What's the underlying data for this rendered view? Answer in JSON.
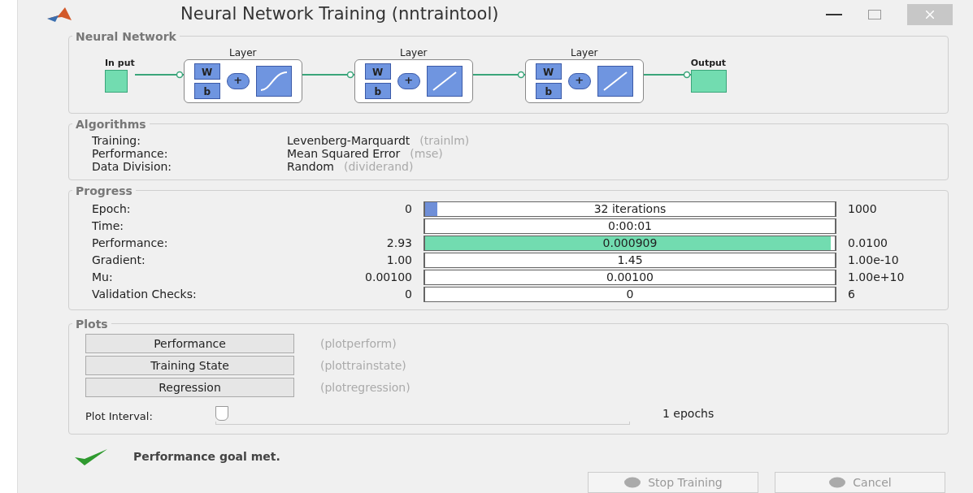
{
  "window": {
    "title": "Neural Network Training (nntraintool)"
  },
  "network": {
    "title": "Neural Network",
    "input": "In put",
    "output": "Output",
    "layers": [
      {
        "label": "Layer",
        "weight": "W",
        "bias": "b",
        "sum": "+",
        "kind": "sigmoid"
      },
      {
        "label": "Layer",
        "weight": "W",
        "bias": "b",
        "sum": "+",
        "kind": "linear"
      },
      {
        "label": "Layer",
        "weight": "W",
        "bias": "b",
        "sum": "+",
        "kind": "linear"
      }
    ]
  },
  "algorithms": {
    "title": "Algorithms",
    "rows": [
      {
        "label": "Training:",
        "value": "Levenberg-Marquardt",
        "code": "(trainlm)"
      },
      {
        "label": "Performance:",
        "value": "Mean Squared Error",
        "code": "(mse)"
      },
      {
        "label": "Data Division:",
        "value": "Random",
        "code": "(dividerand)"
      }
    ]
  },
  "progress": {
    "title": "Progress",
    "rows": [
      {
        "label": "Epoch:",
        "start": "0",
        "bar": "32 iterations",
        "end": "1000",
        "level": 0.03,
        "color": "#6f8fd8"
      },
      {
        "label": "Time:",
        "bar": "0:00:01"
      },
      {
        "label": "Performance:",
        "start": "2.93",
        "bar": "0.000909",
        "end": "0.0100",
        "level": 0.99,
        "color": "#72dcb0"
      },
      {
        "label": "Gradient:",
        "start": "1.00",
        "bar": "1.45",
        "end": "1.00e-10"
      },
      {
        "label": "Mu:",
        "start": "0.00100",
        "bar": "0.00100",
        "end": "1.00e+10"
      },
      {
        "label": "Validation Checks:",
        "start": "0",
        "bar": "0",
        "end": "6"
      }
    ]
  },
  "plots": {
    "title": "Plots",
    "buttons": [
      {
        "label": "Performance",
        "code": "(plotperform)"
      },
      {
        "label": "Training State",
        "code": "(plottrainstate)"
      },
      {
        "label": "Regression",
        "code": "(plotregression)"
      }
    ],
    "interval": {
      "label": "Plot Interval:",
      "level": 0,
      "reading": "1 epochs"
    }
  },
  "status": {
    "text": "Performance goal met.",
    "done": true
  },
  "buttons": [
    {
      "label": "Stop Training",
      "disabled": true
    },
    {
      "label": "Cancel",
      "disabled": true
    }
  ]
}
